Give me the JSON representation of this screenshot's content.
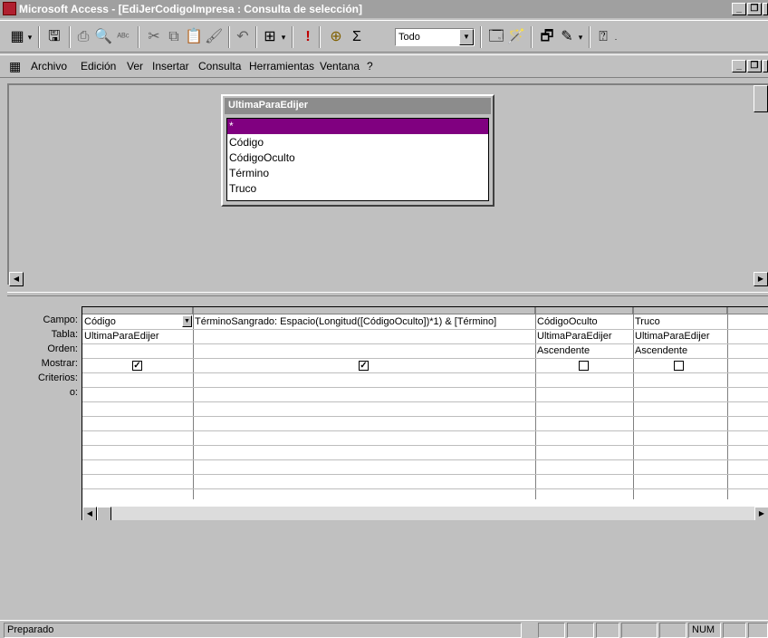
{
  "window": {
    "title": "Microsoft Access - [EdiJerCodigoImpresa : Consulta de selección]",
    "min_glyph": "_",
    "restore_glyph": "❐"
  },
  "toolbar": {
    "filter_value": "Todo",
    "icons": [
      "view-icon",
      "save-icon",
      "print-icon",
      "print-preview-icon",
      "spelling-icon",
      "cut-icon",
      "copy-icon",
      "paste-icon",
      "format-painter-icon",
      "undo-icon",
      "query-type-icon",
      "run-icon",
      "show-table-icon",
      "totals-icon",
      "top-values-icon",
      "properties-icon",
      "build-icon",
      "database-window-icon",
      "new-object-icon",
      "help-icon"
    ]
  },
  "menu": {
    "items": [
      "Archivo",
      "Edición",
      "Ver",
      "Insertar",
      "Consulta",
      "Herramientas",
      "Ventana",
      "?"
    ]
  },
  "field_list": {
    "title": "UltimaParaEdijer",
    "fields": [
      "*",
      "Código",
      "CódigoOculto",
      "Término",
      "Truco"
    ]
  },
  "grid": {
    "row_labels": [
      "Campo:",
      "Tabla:",
      "Orden:",
      "Mostrar:",
      "Criterios:",
      "o:"
    ],
    "columns": [
      {
        "campo": "Código",
        "tabla": "UltimaParaEdijer",
        "orden": "",
        "mostrar": true
      },
      {
        "campo": "TérminoSangrado: Espacio(Longitud([CódigoOculto])*1) & [Término]",
        "tabla": "",
        "orden": "",
        "mostrar": true
      },
      {
        "campo": "CódigoOculto",
        "tabla": "UltimaParaEdijer",
        "orden": "Ascendente",
        "mostrar": false
      },
      {
        "campo": "Truco",
        "tabla": "UltimaParaEdijer",
        "orden": "Ascendente",
        "mostrar": false
      }
    ]
  },
  "status": {
    "text": "Preparado",
    "num": "NUM"
  }
}
